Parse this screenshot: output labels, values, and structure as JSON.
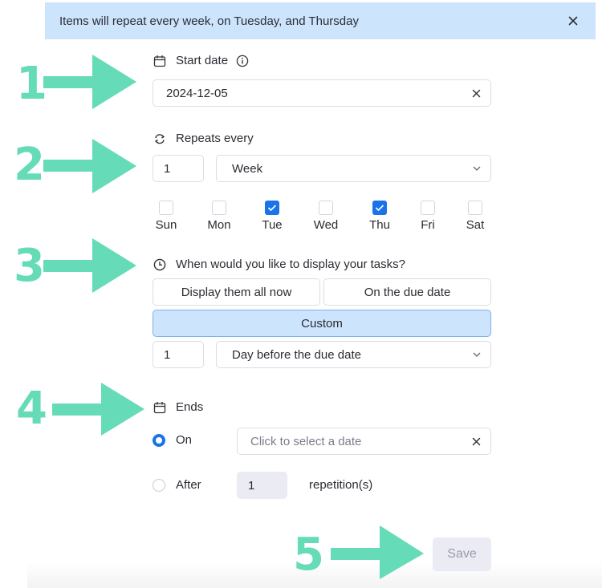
{
  "banner": {
    "message": "Items will repeat every week, on Tuesday, and Thursday",
    "close_icon": "close-icon"
  },
  "start_date": {
    "label": "Start date",
    "icon": "calendar-icon",
    "info_icon": "info-icon",
    "value": "2024-12-05",
    "clear_icon": "close-icon"
  },
  "repeats": {
    "label": "Repeats every",
    "icon": "repeat-icon",
    "interval": "1",
    "unit": "Week",
    "days": [
      {
        "label": "Sun",
        "checked": false
      },
      {
        "label": "Mon",
        "checked": false
      },
      {
        "label": "Tue",
        "checked": true
      },
      {
        "label": "Wed",
        "checked": false
      },
      {
        "label": "Thu",
        "checked": true
      },
      {
        "label": "Fri",
        "checked": false
      },
      {
        "label": "Sat",
        "checked": false
      }
    ]
  },
  "display": {
    "label": "When would you like to display your tasks?",
    "icon": "clock-icon",
    "options": [
      "Display them all now",
      "On the due date",
      "Custom"
    ],
    "selected": "Custom",
    "custom_amount": "1",
    "custom_unit": "Day before the due date"
  },
  "ends": {
    "label": "Ends",
    "icon": "calendar-icon",
    "on_label": "On",
    "on_selected": true,
    "date_placeholder": "Click to select a date",
    "after_label": "After",
    "after_selected": false,
    "repetitions": "1",
    "repetitions_suffix": "repetition(s)"
  },
  "save_label": "Save",
  "annotations": [
    "1",
    "2",
    "3",
    "4",
    "5"
  ],
  "colors": {
    "accent": "#1a73e8",
    "banner_bg": "#cce4fc",
    "annotation": "#66dbb8",
    "save_disabled_bg": "#ebebf4"
  }
}
